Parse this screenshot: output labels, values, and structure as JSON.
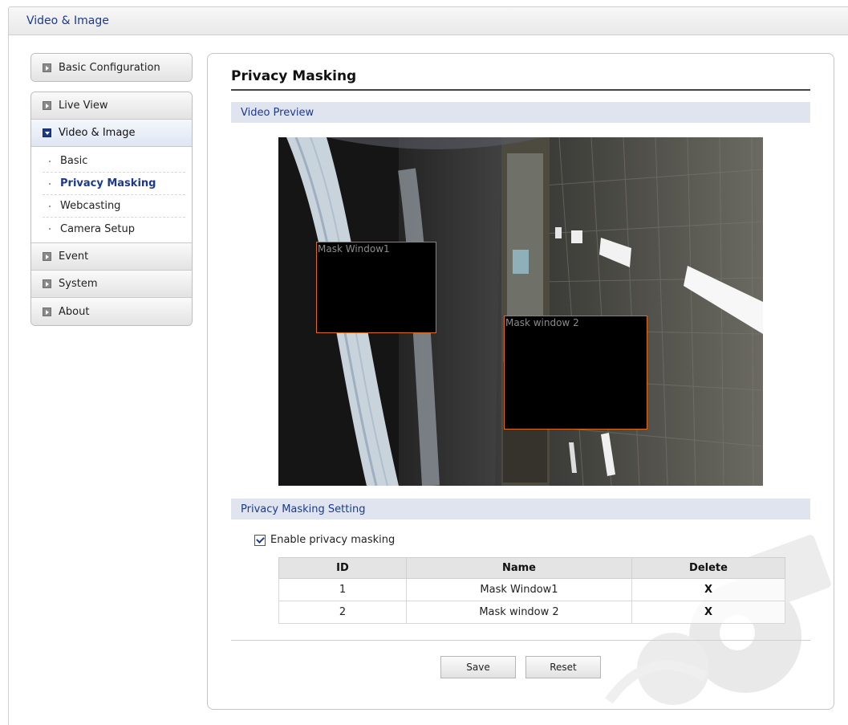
{
  "header": {
    "title": "Video & Image"
  },
  "sidebar": {
    "top_group": {
      "label": "Basic Configuration"
    },
    "groups": [
      {
        "label": "Live View",
        "open": false
      },
      {
        "label": "Video & Image",
        "open": true,
        "children": [
          "Basic",
          "Privacy Masking",
          "Webcasting",
          "Camera Setup"
        ],
        "current": "Privacy Masking"
      },
      {
        "label": "Event",
        "open": false
      },
      {
        "label": "System",
        "open": false
      },
      {
        "label": "About",
        "open": false
      }
    ]
  },
  "main": {
    "title": "Privacy Masking",
    "preview_section": "Video Preview",
    "mask_windows": [
      {
        "label": "Mask Window1"
      },
      {
        "label": "Mask window 2"
      }
    ],
    "settings_section": "Privacy Masking Setting",
    "enable_label": "Enable privacy masking",
    "enable_checked": true,
    "table": {
      "headers": [
        "ID",
        "Name",
        "Delete"
      ],
      "rows": [
        {
          "id": "1",
          "name": "Mask Window1",
          "delete": "X"
        },
        {
          "id": "2",
          "name": "Mask window 2",
          "delete": "X"
        }
      ]
    },
    "buttons": {
      "save": "Save",
      "reset": "Reset"
    }
  },
  "colors": {
    "accent": "#1c3a8c",
    "mask_border": "#e06a1c",
    "section_bg": "#dfe4ee"
  }
}
